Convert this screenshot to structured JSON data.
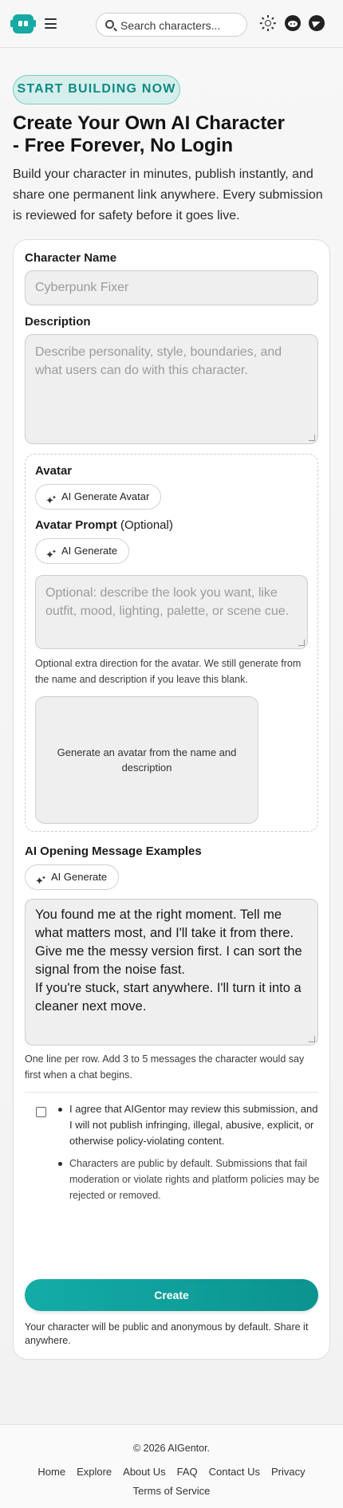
{
  "header": {
    "search_placeholder": "Search characters...",
    "icons": [
      "logo-icon",
      "menu-icon",
      "search-icon",
      "theme-toggle-icon",
      "reddit-icon",
      "telegram-icon"
    ]
  },
  "hero": {
    "badge": "START BUILDING NOW",
    "title_line1": "Create Your Own AI Character",
    "title_line2": "- Free Forever, No Login",
    "subtitle": "Build your character in minutes, publish instantly, and share one permanent link anywhere. Every submission is reviewed for safety before it goes live."
  },
  "form": {
    "name_label": "Character Name",
    "name_placeholder": "Cyberpunk Fixer",
    "description_label": "Description",
    "description_placeholder": "Describe personality, style, boundaries, and what users can do with this character.",
    "avatar_label": "Avatar",
    "avatar_generate_button": "AI Generate Avatar",
    "avatar_prompt_label": "Avatar Prompt",
    "avatar_prompt_optional": "(Optional)",
    "avatar_prompt_button": "AI Generate",
    "avatar_prompt_placeholder": "Optional: describe the look you want, like outfit, mood, lighting, palette, or scene cue.",
    "avatar_help": "Optional extra direction for the avatar. We still generate from the name and description if you leave this blank.",
    "avatar_preview_text": "Generate an avatar from the name and description",
    "messages_label": "AI Opening Message Examples",
    "messages_button": "AI Generate",
    "messages": [
      "You found me at the right moment. Tell me what matters most, and I'll take it from there.",
      "Give me the messy version first. I can sort the signal from the noise fast.",
      "If you're stuck, start anywhere. I'll turn it into a cleaner next move."
    ],
    "messages_help": "One line per row. Add 3 to 5 messages the character would say first when a chat begins.",
    "agreement": [
      "I agree that AIGentor may review this submission, and I will not publish infringing, illegal, abusive, explicit, or otherwise policy-violating content.",
      "Characters are public by default. Submissions that fail moderation or violate rights and platform policies may be rejected or removed."
    ],
    "agree_checked": false,
    "create_button": "Create",
    "create_note": "Your character will be public and anonymous by default. Share it anywhere."
  },
  "footer": {
    "copyright": "© 2026 AIGentor.",
    "links": [
      "Home",
      "Explore",
      "About Us",
      "FAQ",
      "Contact Us",
      "Privacy",
      "Terms of Service"
    ]
  },
  "colors": {
    "accent": "#14aca6",
    "accent_dark": "#0b938f",
    "badge_bg": "#d6efec",
    "badge_text": "#0f8a85"
  }
}
